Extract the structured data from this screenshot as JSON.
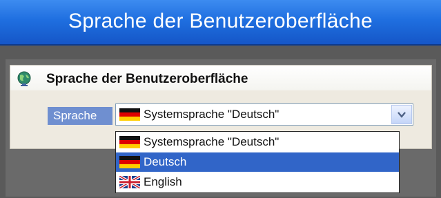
{
  "window": {
    "title": "Sprache der Benutzeroberfläche"
  },
  "panel": {
    "title": "Sprache der Benutzeroberfläche",
    "icon": "globe-icon"
  },
  "language": {
    "label": "Sprache",
    "selected": "Systemsprache \"Deutsch\"",
    "options": [
      {
        "label": "Systemsprache \"Deutsch\"",
        "flag": "german-flag-icon",
        "highlighted": false
      },
      {
        "label": "Deutsch",
        "flag": "german-flag-icon",
        "highlighted": true
      },
      {
        "label": "English",
        "flag": "uk-flag-icon",
        "highlighted": false
      }
    ]
  },
  "colors": {
    "title_bar": "#1f6fe0",
    "highlight": "#3165c8",
    "label_bg": "#6f8fd0"
  }
}
